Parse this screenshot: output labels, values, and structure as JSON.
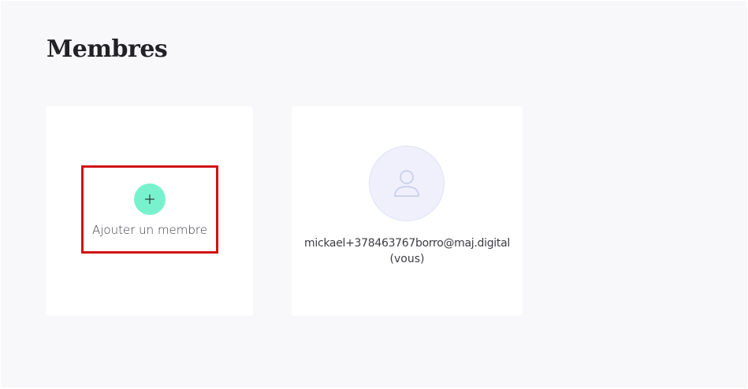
{
  "page": {
    "title": "Membres",
    "background_color": "#f8f8fb"
  },
  "add_member_card": {
    "icon": "plus-icon",
    "label": "Ajouter un membre",
    "icon_color": "#78f2cd",
    "highlight_color": "#d11313"
  },
  "member_card": {
    "avatar_icon": "user-icon",
    "email": "mickael+378463767borro@maj.digital",
    "you_label": "(vous)",
    "avatar_color": "#eff0fb"
  }
}
